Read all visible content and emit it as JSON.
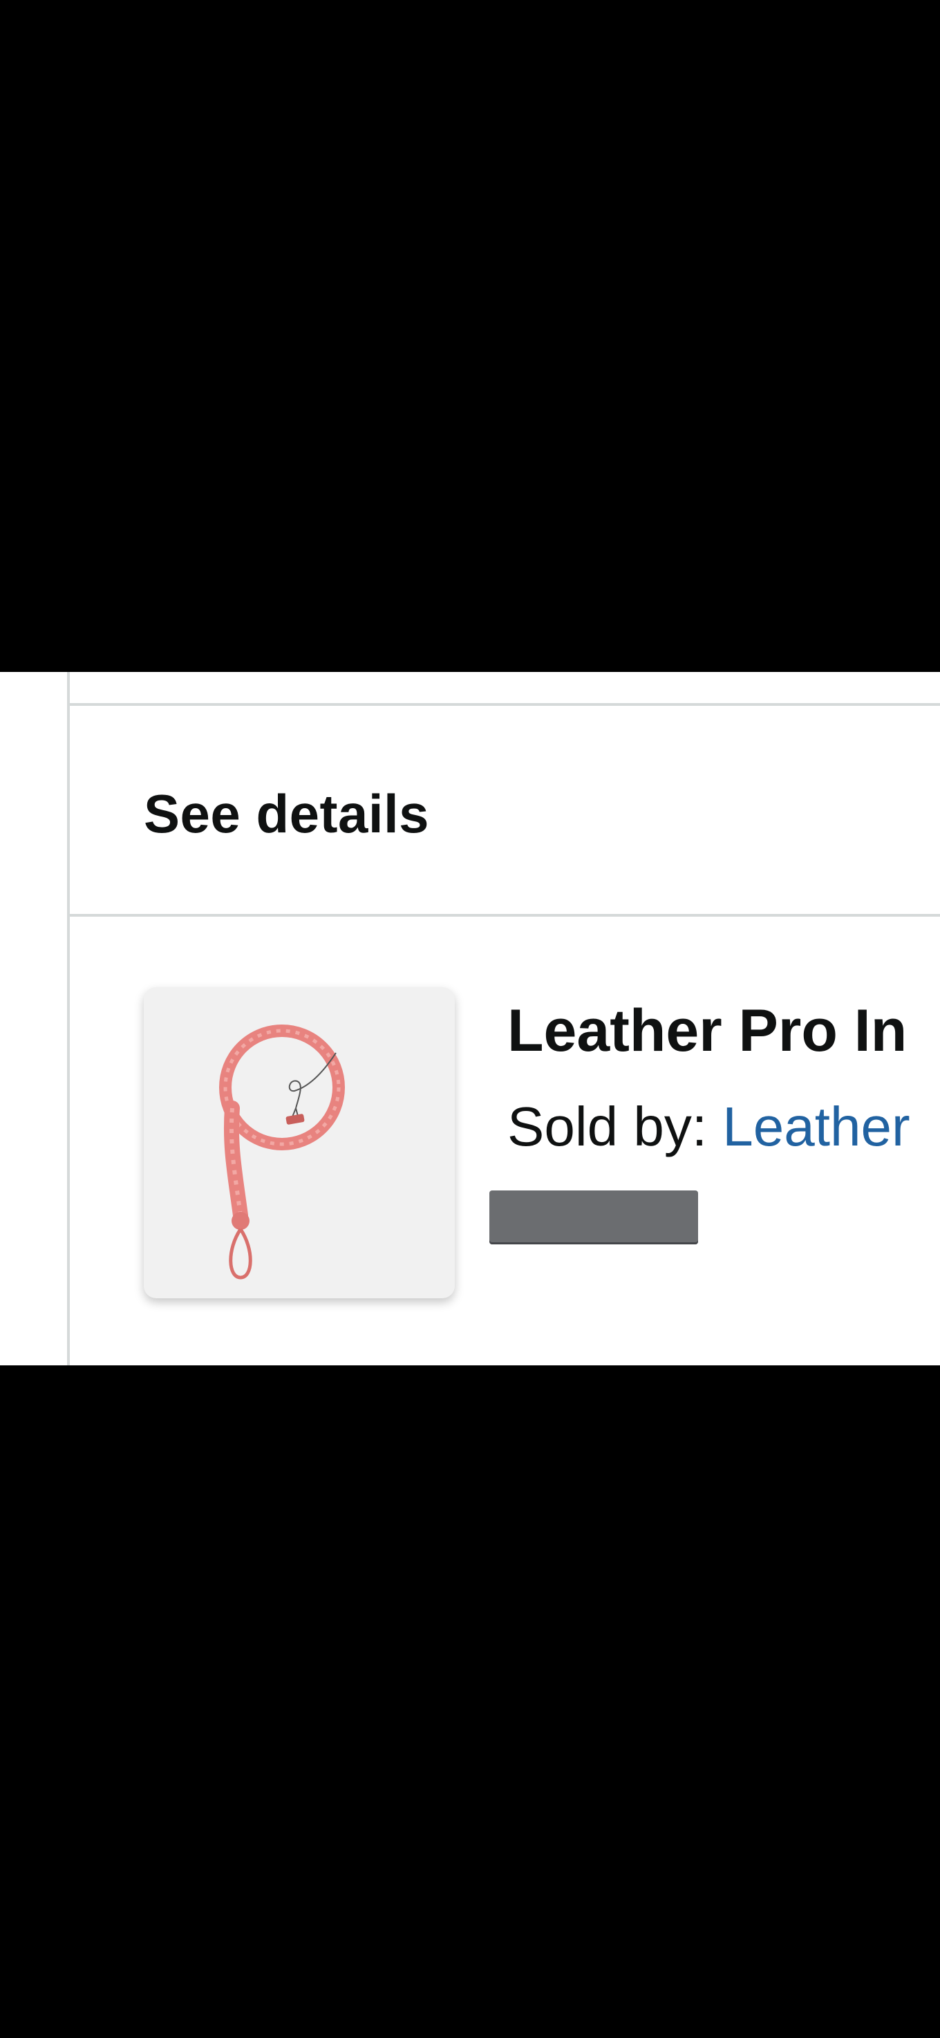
{
  "section": {
    "see_details_label": "See details"
  },
  "product": {
    "image_icon": "bullwhip-product-image",
    "title": "Leather Pro In",
    "sold_by_prefix": "Sold by: ",
    "seller_name": "Leather"
  },
  "colors": {
    "text": "#0f1111",
    "link": "#2162a1",
    "divider": "#d5d9d9",
    "thumb_bg": "#f1f1f1",
    "whip": "#e8837f",
    "redacted": "#6b6d70"
  }
}
